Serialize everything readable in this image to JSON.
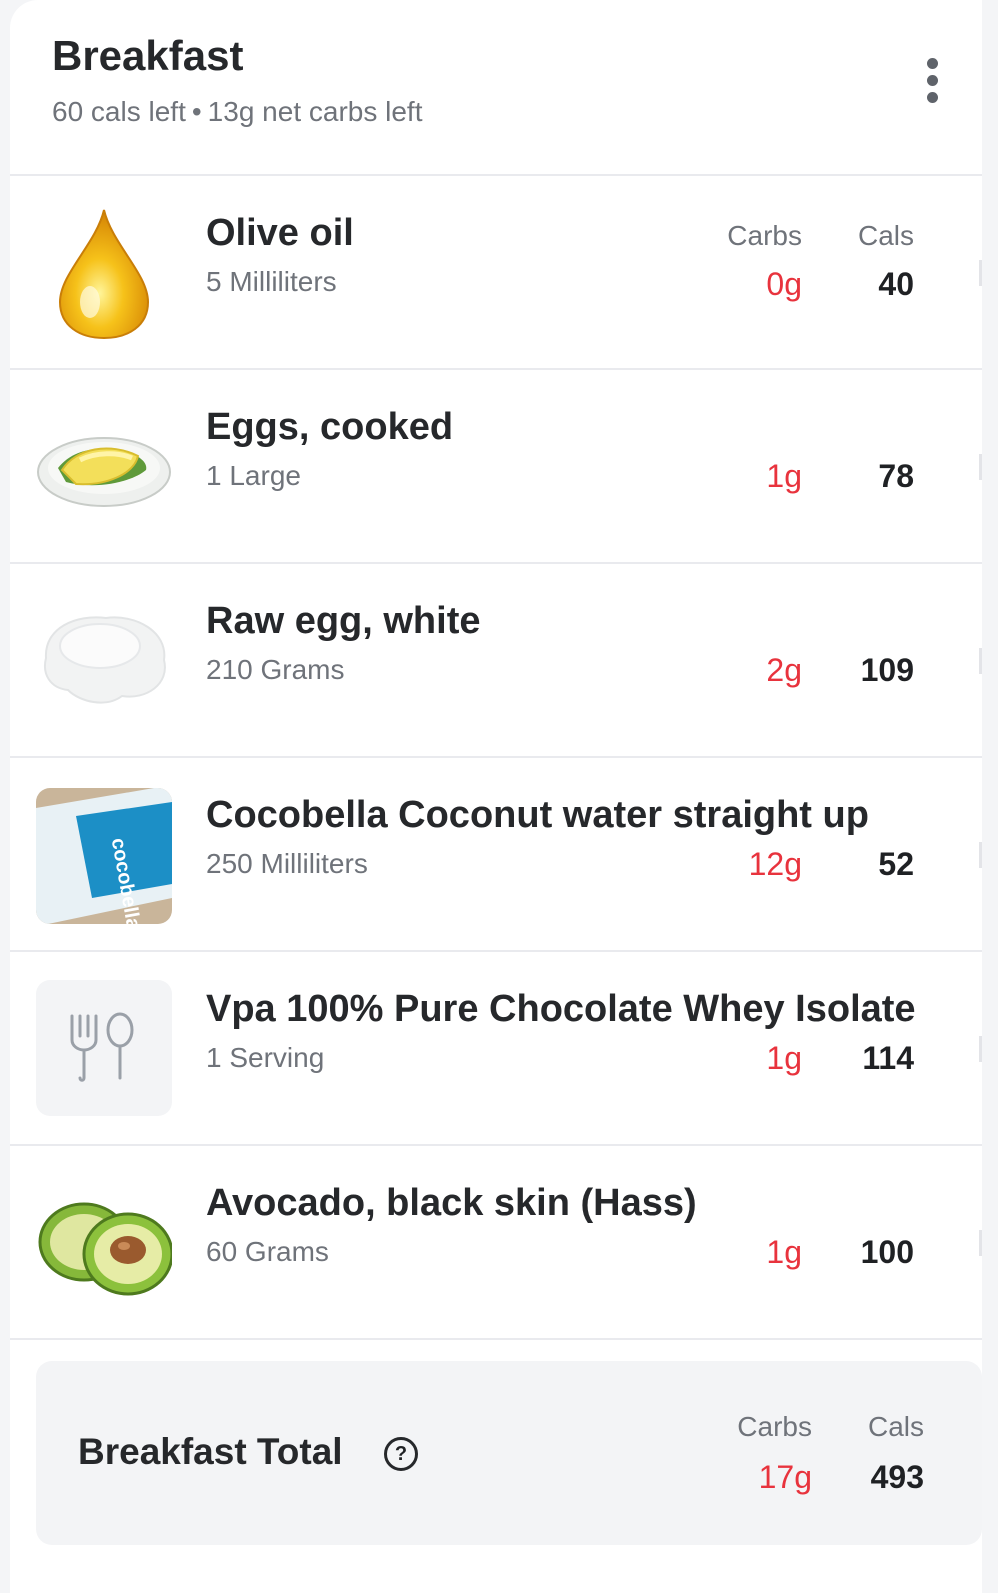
{
  "header": {
    "title": "Breakfast",
    "cals_left": "60 cals left",
    "separator": "•",
    "carbs_left": "13g net carbs left",
    "menu_icon": "more-vertical-icon"
  },
  "columns": {
    "carbs": "Carbs",
    "cals": "Cals"
  },
  "colors": {
    "carbs": "#e8333d",
    "text": "#26282b",
    "muted": "#6f737a",
    "divider": "#e9eaee"
  },
  "items": [
    {
      "name": "Olive oil",
      "qty": "5 Milliliters",
      "carbs": "0g",
      "cals": "40",
      "icon": "olive-oil-drop-icon"
    },
    {
      "name": "Eggs, cooked",
      "qty": "1 Large",
      "carbs": "1g",
      "cals": "78",
      "icon": "cooked-eggs-icon"
    },
    {
      "name": "Raw egg, white",
      "qty": "210 Grams",
      "carbs": "2g",
      "cals": "109",
      "icon": "egg-white-icon"
    },
    {
      "name": "Cocobella Coconut water straight up",
      "qty": "250 Milliliters",
      "carbs": "12g",
      "cals": "52",
      "icon": "coconut-water-photo",
      "photo_text": "cocobella"
    },
    {
      "name": "Vpa 100% Pure Chocolate Whey Isolate",
      "qty": "1 Serving",
      "carbs": "1g",
      "cals": "114",
      "icon": "fork-spoon-icon"
    },
    {
      "name": "Avocado, black skin (Hass)",
      "qty": "60 Grams",
      "carbs": "1g",
      "cals": "100",
      "icon": "avocado-icon"
    }
  ],
  "total": {
    "label": "Breakfast Total",
    "help_icon": "help-circle-icon",
    "help_glyph": "?",
    "carbs": "17g",
    "cals": "493"
  }
}
